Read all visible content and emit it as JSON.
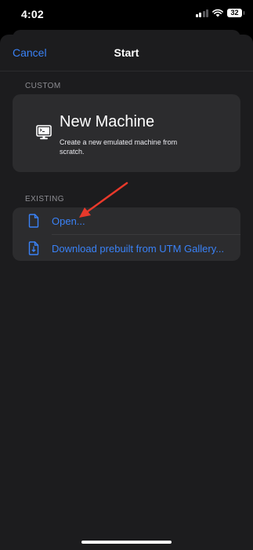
{
  "status_bar": {
    "time": "4:02",
    "battery": "32",
    "icons": [
      "signal-icon",
      "wifi-icon",
      "battery-icon"
    ]
  },
  "nav": {
    "cancel_label": "Cancel",
    "title": "Start"
  },
  "custom_section": {
    "header": "CUSTOM",
    "new_machine": {
      "title": "New Machine",
      "description": "Create a new emulated machine from scratch.",
      "icon": "monitor-icon"
    }
  },
  "existing_section": {
    "header": "EXISTING",
    "items": [
      {
        "label": "Open...",
        "icon": "document-icon"
      },
      {
        "label": "Download prebuilt from UTM Gallery...",
        "icon": "download-document-icon"
      }
    ]
  },
  "colors": {
    "accent": "#3a82f7",
    "background": "#000000",
    "sheet": "#1c1c1e",
    "card": "#2c2c2e",
    "annotation_arrow": "#e8392b"
  }
}
